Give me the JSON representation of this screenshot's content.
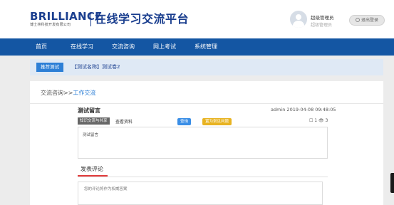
{
  "header": {
    "logo_en": "BRILLIANCE",
    "logo_cn": "博士林科技开发有限公司",
    "site_title": "在线学习交流平台",
    "user_name": "超级管理员",
    "user_role": "超级管理员",
    "logout_label": "退出登录"
  },
  "nav": {
    "items": [
      {
        "label": "首页"
      },
      {
        "label": "在线学习"
      },
      {
        "label": "交流咨询"
      },
      {
        "label": "网上考试"
      },
      {
        "label": "系统管理"
      }
    ]
  },
  "recommend": {
    "tag": "推荐测试",
    "text": "【测试名称】测试卷2"
  },
  "breadcrumb": {
    "parent": "交流咨询>>",
    "current": "工作交流"
  },
  "post": {
    "title": "测试留言",
    "author_time": "admin 2019-04-08 09:48:05",
    "category": "知识交流与共享",
    "view_label": "查看资料",
    "query_button": "查询",
    "set_button": "置为常见问题",
    "stats": "☐ 1 👁 3",
    "content": "测试留言"
  },
  "comment": {
    "label": "发表评论",
    "placeholder": "您的评论将作为权威答案"
  },
  "colors": {
    "brand": "#1b3f8f",
    "nav_bg": "#1456a3",
    "accent_blue": "#2d7fd6",
    "accent_yellow": "#e8b321",
    "accent_red": "#e23b3b"
  }
}
